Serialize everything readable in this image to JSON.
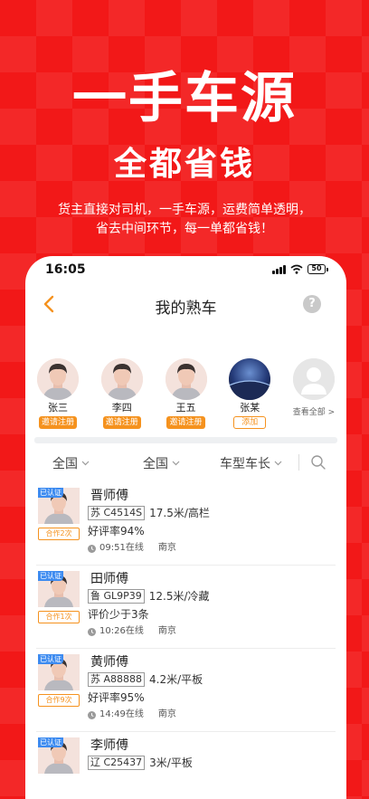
{
  "hero": {
    "title": "一手车源",
    "subtitle": "全都省钱",
    "desc_line1": "货主直接对司机，一手车源，运费简单透明，",
    "desc_line2": "省去中间环节，每一单都省钱！"
  },
  "status_bar": {
    "time": "16:05",
    "battery": "50"
  },
  "nav": {
    "title": "我的熟车",
    "help_label": "?"
  },
  "friends": [
    {
      "name": "张三",
      "action": "邀请注册"
    },
    {
      "name": "李四",
      "action": "邀请注册"
    },
    {
      "name": "王五",
      "action": "邀请注册"
    },
    {
      "name": "张某",
      "action": "添加"
    }
  ],
  "view_all": "查看全部 >",
  "filters": [
    "全国",
    "全国",
    "车型车长"
  ],
  "verified_label": "已认证",
  "drivers": [
    {
      "name": "晋师傅",
      "plate": "苏 C4514S",
      "spec": "17.5米/高栏",
      "coop": "合作2次",
      "rating": "好评率94%",
      "time": "09:51在线",
      "city": "南京"
    },
    {
      "name": "田师傅",
      "plate": "鲁 GL9P39",
      "spec": "12.5米/冷藏",
      "coop": "合作1次",
      "rating": "评价少于3条",
      "time": "10:26在线",
      "city": "南京"
    },
    {
      "name": "黄师傅",
      "plate": "苏 A88888",
      "spec": "4.2米/平板",
      "coop": "合作9次",
      "rating": "好评率95%",
      "time": "14:49在线",
      "city": "南京"
    },
    {
      "name": "李师傅",
      "plate": "辽 C25437",
      "spec": "3米/平板",
      "coop": "",
      "rating": "",
      "time": "",
      "city": ""
    }
  ]
}
